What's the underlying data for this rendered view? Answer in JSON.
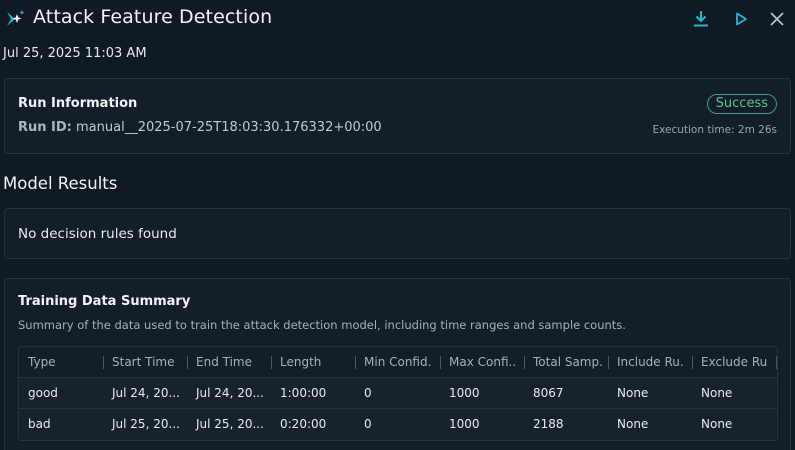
{
  "header": {
    "title": "Attack Feature Detection",
    "timestamp": "Jul 25, 2025 11:03 AM",
    "icons": [
      "sparkle-icon",
      "download-icon",
      "play-icon",
      "close-icon"
    ]
  },
  "run_info": {
    "title": "Run Information",
    "run_id_label": "Run ID:",
    "run_id_value": "manual__2025-07-25T18:03:30.176332+00:00",
    "status": "Success",
    "execution_time": "Execution time: 2m 26s"
  },
  "model_results": {
    "title": "Model Results",
    "message": "No decision rules found"
  },
  "training": {
    "title": "Training Data Summary",
    "description": "Summary of the data used to train the attack detection model, including time ranges and sample counts.",
    "columns": [
      "Type",
      "Start Time",
      "End Time",
      "Length",
      "Min Confid...",
      "Max Confi...",
      "Total Samp...",
      "Include Ru...",
      "Exclude Ru..."
    ],
    "rows": [
      [
        "good",
        "Jul 24, 20...",
        "Jul 24, 20...",
        "1:00:00",
        "0",
        "1000",
        "8067",
        "None",
        "None"
      ],
      [
        "bad",
        "Jul 25, 20...",
        "Jul 25, 20...",
        "0:20:00",
        "0",
        "1000",
        "2188",
        "None",
        "None"
      ]
    ]
  },
  "colors": {
    "background": "#101a23",
    "card": "#131e28",
    "accent": "#1fb6d9",
    "success": "#54c594"
  }
}
